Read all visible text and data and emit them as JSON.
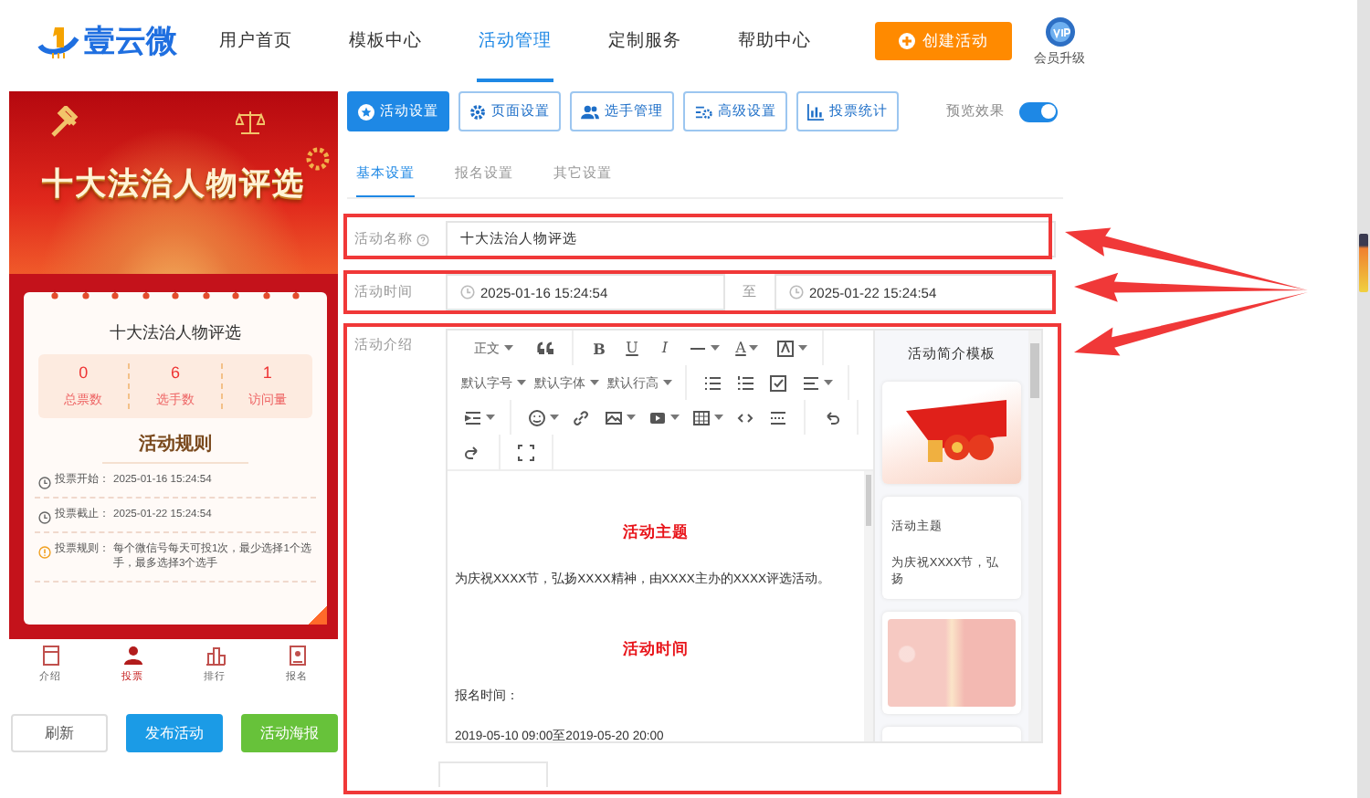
{
  "header": {
    "logo_text": "壹云微",
    "nav": [
      {
        "label": "用户首页",
        "selected": false
      },
      {
        "label": "模板中心",
        "selected": false
      },
      {
        "label": "活动管理",
        "selected": true
      },
      {
        "label": "定制服务",
        "selected": false
      },
      {
        "label": "帮助中心",
        "selected": false
      }
    ],
    "create_button": "创建活动",
    "upgrade_label": "会员升级"
  },
  "preview": {
    "banner_title": "十大法治人物评选",
    "activity_title": "十大法治人物评选",
    "stats": [
      {
        "value": "0",
        "label": "总票数"
      },
      {
        "value": "6",
        "label": "选手数"
      },
      {
        "value": "1",
        "label": "访问量"
      }
    ],
    "rules_title": "活动规则",
    "rules": [
      {
        "kind": "clock",
        "label": "投票开始：",
        "text": "2025-01-16 15:24:54"
      },
      {
        "kind": "clock",
        "label": "投票截止：",
        "text": "2025-01-22 15:24:54"
      },
      {
        "kind": "info",
        "label": "投票规则：",
        "text": "每个微信号每天可投1次，最少选择1个选手，最多选择3个选手"
      }
    ],
    "bottom_nav": [
      {
        "label": "介绍",
        "selected": false
      },
      {
        "label": "投票",
        "selected": true
      },
      {
        "label": "排行",
        "selected": false
      },
      {
        "label": "报名",
        "selected": false
      }
    ],
    "actions": [
      {
        "label": "刷新",
        "kind": "plain"
      },
      {
        "label": "发布活动",
        "kind": "primary"
      },
      {
        "label": "活动海报",
        "kind": "success"
      }
    ]
  },
  "settings": {
    "tabs": [
      {
        "label": "活动设置",
        "selected": true
      },
      {
        "label": "页面设置",
        "selected": false
      },
      {
        "label": "选手管理",
        "selected": false
      },
      {
        "label": "高级设置",
        "selected": false
      },
      {
        "label": "投票统计",
        "selected": false
      }
    ],
    "preview_toggle": {
      "label": "预览效果",
      "on": true
    },
    "subtabs": [
      {
        "label": "基本设置",
        "selected": true
      },
      {
        "label": "报名设置",
        "selected": false
      },
      {
        "label": "其它设置",
        "selected": false
      }
    ],
    "name_field": {
      "label": "活动名称",
      "value": "十大法治人物评选"
    },
    "time_field": {
      "label": "活动时间",
      "start": "2025-01-16 15:24:54",
      "separator": "至",
      "end": "2025-01-22 15:24:54"
    },
    "intro": {
      "label": "活动介绍",
      "toolbar": [
        [
          {
            "kind": "dropdown",
            "text": "正文"
          },
          {
            "kind": "icon"
          }
        ],
        [
          {
            "kind": "bold",
            "text": "B"
          },
          {
            "kind": "underline",
            "text": "U"
          },
          {
            "kind": "italic",
            "text": "I"
          },
          {
            "kind": "icon-dropdown"
          },
          {
            "kind": "glyph-dropdown",
            "text": "A"
          },
          {
            "kind": "icon-dropdown"
          }
        ],
        [
          {
            "kind": "dropdown",
            "text": "默认字号"
          },
          {
            "kind": "dropdown",
            "text": "默认字体"
          },
          {
            "kind": "dropdown",
            "text": "默认行高"
          }
        ],
        [
          {
            "kind": "icon"
          },
          {
            "kind": "icon"
          },
          {
            "kind": "icon"
          },
          {
            "kind": "icon-dropdown"
          }
        ],
        [
          {
            "kind": "icon-dropdown"
          }
        ],
        [
          {
            "kind": "icon-dropdown"
          },
          {
            "kind": "icon"
          },
          {
            "kind": "icon-dropdown"
          },
          {
            "kind": "icon-dropdown"
          },
          {
            "kind": "icon-dropdown"
          },
          {
            "kind": "icon"
          },
          {
            "kind": "icon"
          }
        ],
        [
          {
            "kind": "icon"
          }
        ],
        [
          {
            "kind": "icon"
          }
        ],
        [
          {
            "kind": "icon"
          }
        ]
      ],
      "content": [
        {
          "kind": "heading",
          "text": "活动主题"
        },
        {
          "kind": "paragraph",
          "text": "为庆祝XXXX节，弘扬XXXX精神，由XXXX主办的XXXX评选活动。"
        },
        {
          "kind": "heading",
          "text": "活动时间"
        },
        {
          "kind": "paragraph",
          "text": "报名时间："
        },
        {
          "kind": "paragraph",
          "text": "2019-05-10 09:00至2019-05-20 20:00"
        }
      ],
      "templates_title": "活动简介模板",
      "templates": [
        {
          "kind": "flag-image"
        },
        {
          "kind": "text",
          "title": "活动主题",
          "body": "为庆祝XXXX节，弘扬"
        },
        {
          "kind": "pink-image"
        },
        {
          "kind": "blank"
        }
      ]
    }
  }
}
